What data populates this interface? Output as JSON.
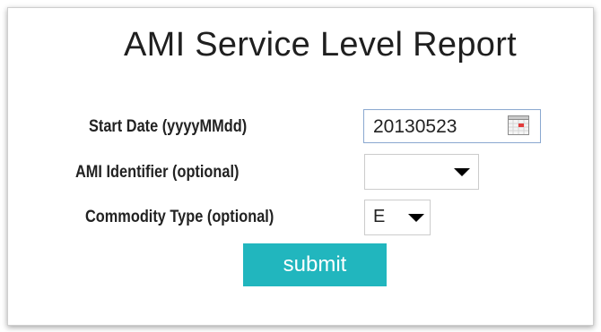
{
  "page": {
    "title": "AMI Service Level Report"
  },
  "form": {
    "start_date": {
      "label": "Start Date (yyyyMMdd)",
      "value": "20130523",
      "icon": "calendar-icon"
    },
    "ami_identifier": {
      "label": "AMI Identifier (optional)",
      "value": "",
      "icon": "chevron-down-icon"
    },
    "commodity_type": {
      "label": "Commodity Type (optional)",
      "value": "E",
      "icon": "chevron-down-icon"
    },
    "submit_label": "submit"
  },
  "colors": {
    "submit_background": "#21b6be",
    "submit_text": "#ffffff",
    "date_input_border": "#8aa8d0"
  }
}
